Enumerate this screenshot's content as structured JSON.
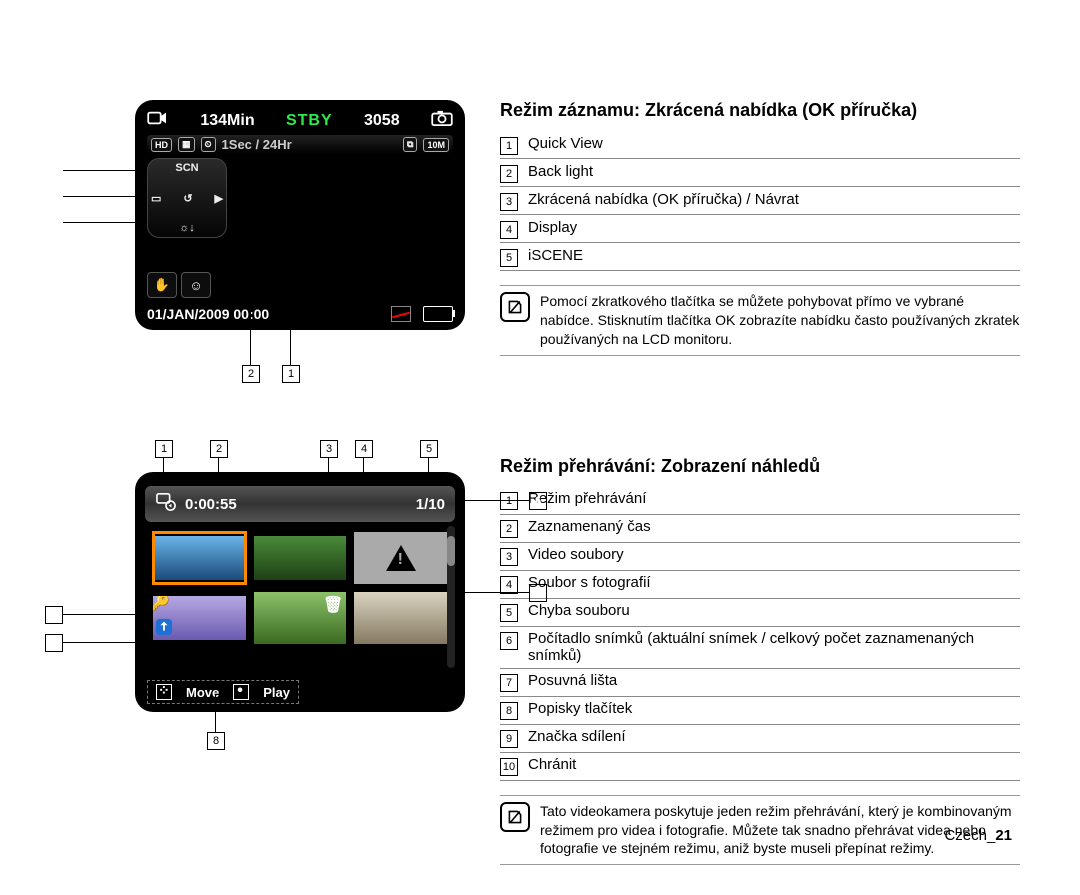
{
  "lcd1": {
    "minutes": "134Min",
    "status": "STBY",
    "photos_remaining": "3058",
    "interval": "1Sec / 24Hr",
    "resolution_badges": [
      "HD",
      "10M"
    ],
    "datetime": "01/JAN/2009  00:00"
  },
  "section1": {
    "heading": "Režim záznamu: Zkrácená nabídka (OK příručka)",
    "items": [
      "Quick View",
      "Back light",
      "Zkrácená nabídka (OK příručka) / Návrat",
      "Display",
      "iSCENE"
    ],
    "note": "Pomocí zkratkového tlačítka se můžete pohybovat přímo ve vybrané nabídce.  Stisknutím tlačítka OK zobrazíte nabídku často používaných zkratek používaných na LCD monitoru."
  },
  "lcd2": {
    "elapsed": "0:00:55",
    "counter": "1/10",
    "move_label": "Move",
    "play_label": "Play"
  },
  "section2": {
    "heading": "Režim přehrávání: Zobrazení náhledů",
    "items": [
      "Režim přehrávání",
      "Zaznamenaný čas",
      "Video soubory",
      "Soubor s fotografií",
      "Chyba souboru",
      "Počítadlo snímků (aktuální snímek / celkový počet zaznamenaných snímků)",
      "Posuvná lišta",
      "Popisky tlačítek",
      "Značka sdílení",
      "Chránit"
    ],
    "note": "Tato videokamera poskytuje jeden režim přehrávání, který je kombinovaným režimem pro videa i fotografie. Můžete tak snadno přehrávat videa nebo fotografie ve stejném režimu, aniž byste museli přepínat režimy."
  },
  "footer": {
    "lang": "Czech",
    "sep": "_",
    "page": "21"
  }
}
